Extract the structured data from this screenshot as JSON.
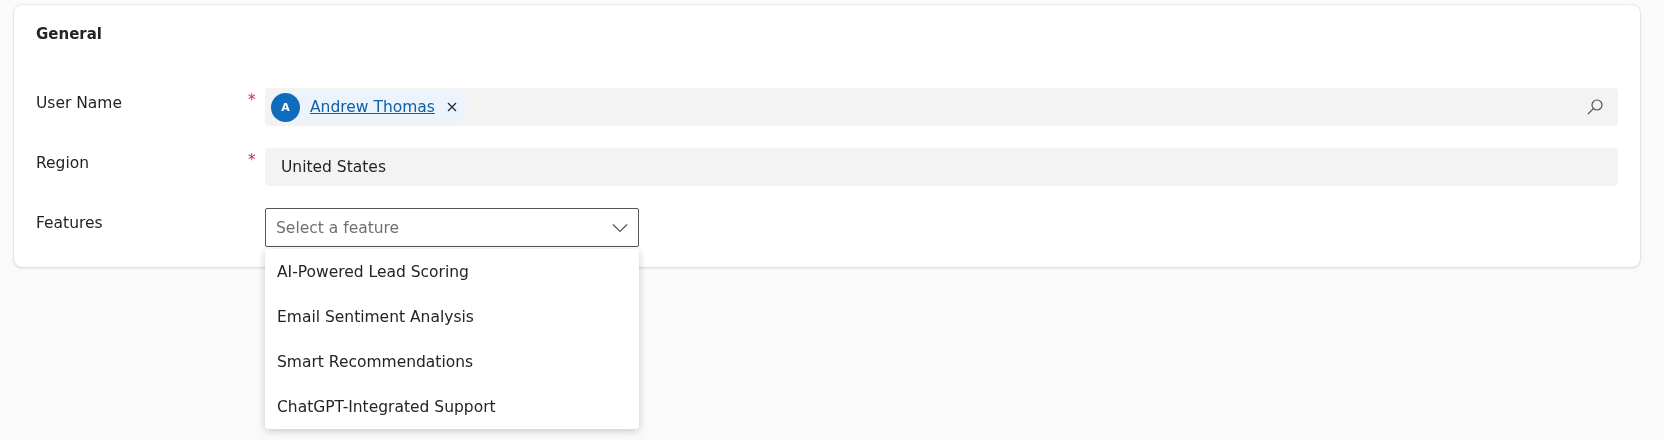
{
  "section": {
    "title": "General"
  },
  "fields": [
    {
      "kind": "people",
      "label": "User Name",
      "required_mark": "*",
      "person": {
        "initial": "A",
        "name": "Andrew Thomas"
      }
    },
    {
      "kind": "text",
      "label": "Region",
      "required_mark": "*",
      "value": "United States"
    },
    {
      "kind": "dropdown",
      "label": "Features",
      "placeholder": "Select a feature",
      "expanded": true,
      "options": [
        {
          "label": "AI-Powered Lead Scoring",
          "selected": false
        },
        {
          "label": "Email Sentiment Analysis",
          "selected": false
        },
        {
          "label": "Smart Recommendations",
          "selected": false
        },
        {
          "label": "ChatGPT-Integrated Support",
          "selected": false
        }
      ]
    }
  ]
}
